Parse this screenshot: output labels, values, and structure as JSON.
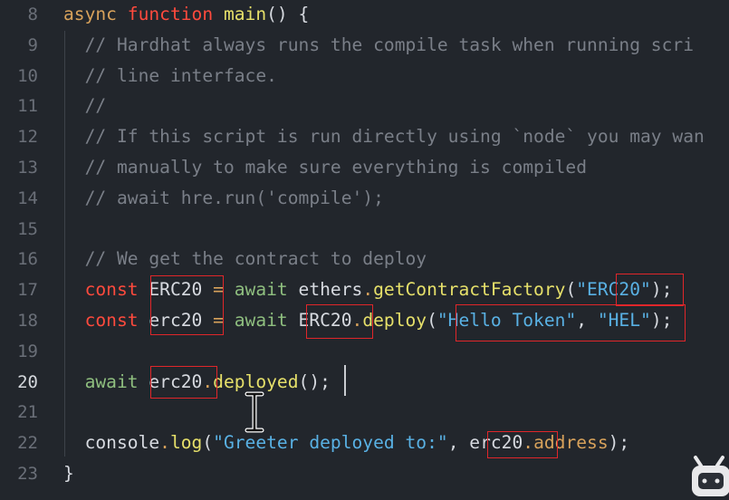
{
  "editor": {
    "lines": [
      {
        "num": "8",
        "t": [
          {
            "c": "kw",
            "v": "async"
          },
          {
            "c": "pl",
            "v": " "
          },
          {
            "c": "rd",
            "v": "function"
          },
          {
            "c": "pl",
            "v": " "
          },
          {
            "c": "fn",
            "v": "main"
          },
          {
            "c": "pl",
            "v": "() {"
          }
        ]
      },
      {
        "num": "9",
        "t": [
          {
            "c": "cm",
            "v": "  // Hardhat always runs the compile task when running scri"
          }
        ]
      },
      {
        "num": "10",
        "t": [
          {
            "c": "cm",
            "v": "  // line interface."
          }
        ]
      },
      {
        "num": "11",
        "t": [
          {
            "c": "cm",
            "v": "  //"
          }
        ]
      },
      {
        "num": "12",
        "t": [
          {
            "c": "cm",
            "v": "  // If this script is run directly using `node` you may wan"
          }
        ]
      },
      {
        "num": "13",
        "t": [
          {
            "c": "cm",
            "v": "  // manually to make sure everything is compiled"
          }
        ]
      },
      {
        "num": "14",
        "t": [
          {
            "c": "cm",
            "v": "  // await hre.run('compile');"
          }
        ]
      },
      {
        "num": "15",
        "t": []
      },
      {
        "num": "16",
        "t": [
          {
            "c": "cm",
            "v": "  // We get the contract to deploy"
          }
        ]
      },
      {
        "num": "17",
        "t": [
          {
            "c": "pl",
            "v": "  "
          },
          {
            "c": "rd",
            "v": "const"
          },
          {
            "c": "pl",
            "v": " ERC20 "
          },
          {
            "c": "kw",
            "v": "="
          },
          {
            "c": "pl",
            "v": " "
          },
          {
            "c": "lt",
            "v": "await"
          },
          {
            "c": "pl",
            "v": " ethers"
          },
          {
            "c": "kw",
            "v": "."
          },
          {
            "c": "fn",
            "v": "getContractFactory"
          },
          {
            "c": "pl",
            "v": "("
          },
          {
            "c": "str",
            "v": "\"ERC20\""
          },
          {
            "c": "pl",
            "v": ");"
          }
        ]
      },
      {
        "num": "18",
        "t": [
          {
            "c": "pl",
            "v": "  "
          },
          {
            "c": "rd",
            "v": "const"
          },
          {
            "c": "pl",
            "v": " erc20 "
          },
          {
            "c": "kw",
            "v": "="
          },
          {
            "c": "pl",
            "v": " "
          },
          {
            "c": "lt",
            "v": "await"
          },
          {
            "c": "pl",
            "v": " ERC20"
          },
          {
            "c": "kw",
            "v": "."
          },
          {
            "c": "fn",
            "v": "deploy"
          },
          {
            "c": "pl",
            "v": "("
          },
          {
            "c": "str",
            "v": "\"Hello Token\""
          },
          {
            "c": "pl",
            "v": ", "
          },
          {
            "c": "str",
            "v": "\"HEL\""
          },
          {
            "c": "pl",
            "v": ");"
          }
        ]
      },
      {
        "num": "19",
        "t": []
      },
      {
        "num": "20",
        "t": [
          {
            "c": "pl",
            "v": "  "
          },
          {
            "c": "lt",
            "v": "await"
          },
          {
            "c": "pl",
            "v": " erc20"
          },
          {
            "c": "kw",
            "v": "."
          },
          {
            "c": "fn",
            "v": "deployed"
          },
          {
            "c": "pl",
            "v": "();"
          }
        ]
      },
      {
        "num": "21",
        "t": []
      },
      {
        "num": "22",
        "t": [
          {
            "c": "pl",
            "v": "  console"
          },
          {
            "c": "kw",
            "v": "."
          },
          {
            "c": "fn",
            "v": "log"
          },
          {
            "c": "pl",
            "v": "("
          },
          {
            "c": "str",
            "v": "\"Greeter deployed to:\""
          },
          {
            "c": "pl",
            "v": ", erc20"
          },
          {
            "c": "kw",
            "v": "."
          },
          {
            "c": "kw",
            "v": "address"
          },
          {
            "c": "pl",
            "v": ");"
          }
        ]
      },
      {
        "num": "23",
        "t": [
          {
            "c": "pl",
            "v": "}"
          }
        ]
      }
    ],
    "active_line": "20",
    "colors": {
      "background": "#22262c",
      "keyword": "#d8a25b",
      "function_keyword": "#ff4a3d",
      "function_name": "#e6e06a",
      "comment": "#7a7f88",
      "string": "#59b1e4",
      "await": "#8fbf7f",
      "annotation_box": "#e0262a"
    }
  }
}
